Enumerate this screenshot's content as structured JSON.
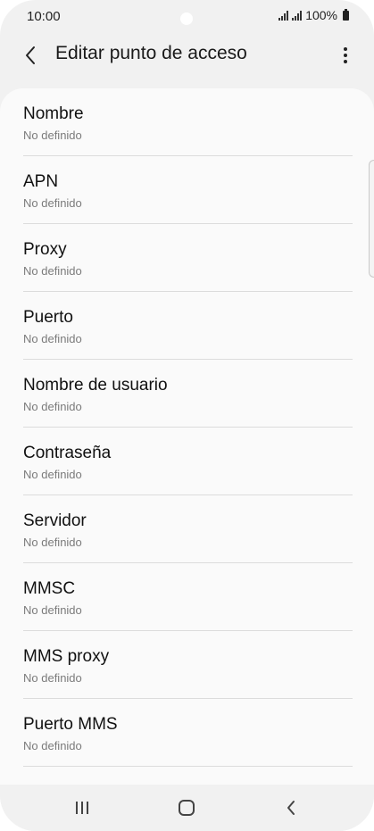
{
  "status_bar": {
    "time": "10:00",
    "battery_text": "100%"
  },
  "header": {
    "title": "Editar punto de acceso",
    "back_icon": "chevron-left-icon",
    "menu_icon": "more-vertical-icon"
  },
  "settings": [
    {
      "label": "Nombre",
      "value": "No definido"
    },
    {
      "label": "APN",
      "value": "No definido"
    },
    {
      "label": "Proxy",
      "value": "No definido"
    },
    {
      "label": "Puerto",
      "value": "No definido"
    },
    {
      "label": "Nombre de usuario",
      "value": "No definido"
    },
    {
      "label": "Contraseña",
      "value": "No definido"
    },
    {
      "label": "Servidor",
      "value": "No definido"
    },
    {
      "label": "MMSC",
      "value": "No definido"
    },
    {
      "label": "MMS proxy",
      "value": "No definido"
    },
    {
      "label": "Puerto MMS",
      "value": "No definido"
    }
  ],
  "nav_bar": {
    "recents_icon": "recent-apps-icon",
    "home_icon": "home-icon",
    "back_icon": "back-icon"
  }
}
